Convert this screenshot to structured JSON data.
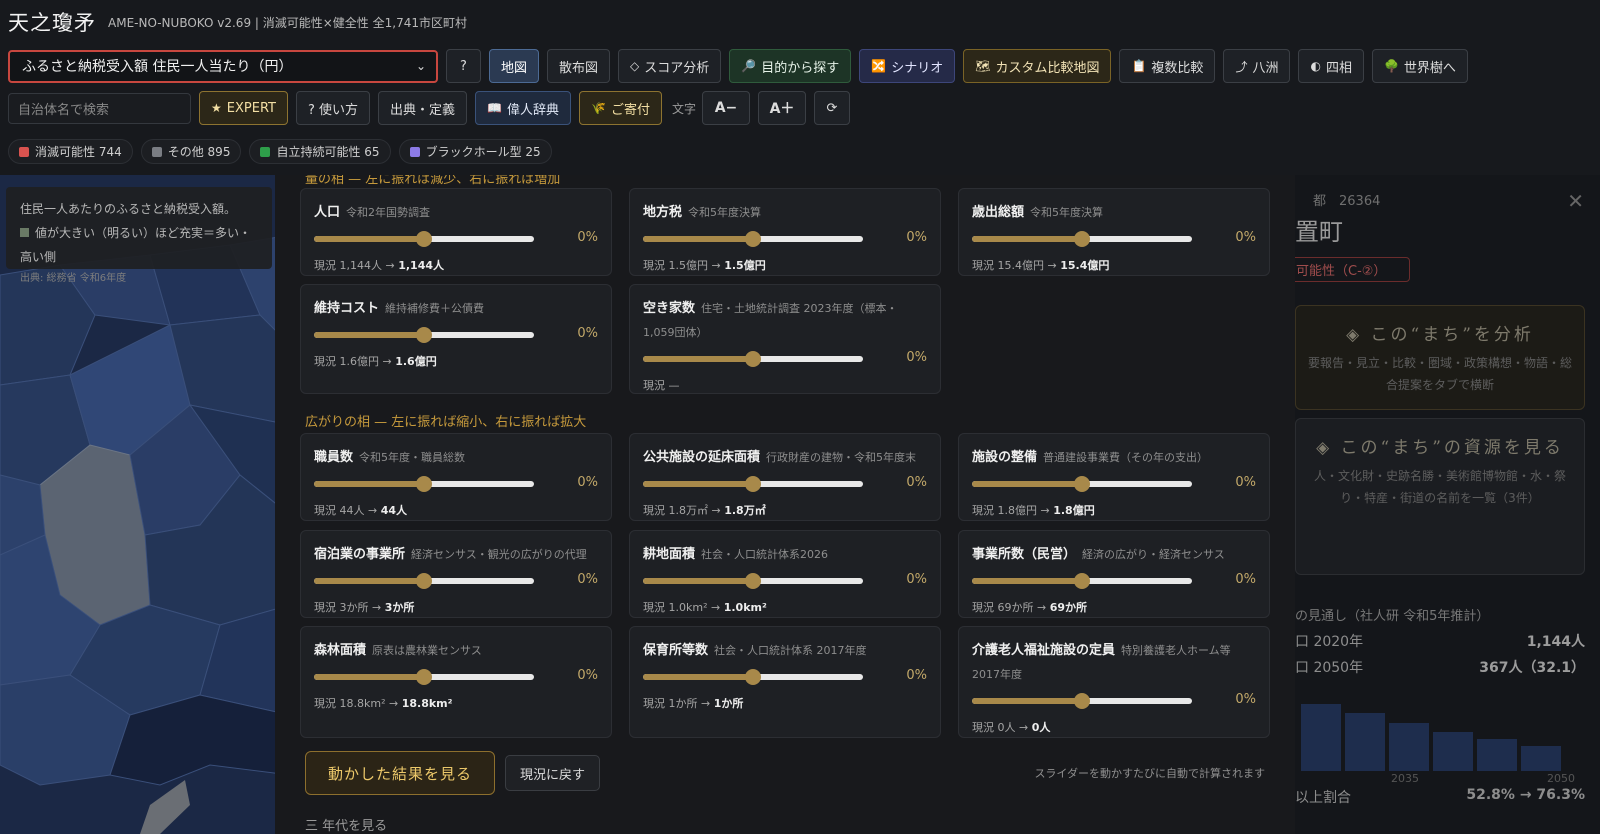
{
  "app": {
    "title": "天之瓊矛",
    "subtitle": "AME-NO-NUBOKO v2.69 | 消滅可能性×健全性 全1,741市区町村"
  },
  "toolbar": {
    "metric_select": "ふるさと納税受入額 住民一人当たり（円）",
    "help": "?",
    "buttons": [
      "地図",
      "散布図",
      "スコア分析",
      "目的から探す",
      "シナリオ",
      "カスタム比較地図",
      "複数比較",
      "八洲",
      "四相",
      "世界樹へ"
    ],
    "active": "地図"
  },
  "toolbar2": {
    "search_placeholder": "自治体名で検索",
    "expert": "EXPERT",
    "howto": "? 使い方",
    "sources": "出典・定義",
    "dictionary": "偉人辞典",
    "donate": "ご寄付",
    "text_label": "文字",
    "font_down": "A−",
    "font_up": "A＋",
    "refresh": "⟳"
  },
  "legend": [
    {
      "label": "消滅可能性 744",
      "color": "#d9534f"
    },
    {
      "label": "その他 895",
      "color": "#7a7d83"
    },
    {
      "label": "自立持続可能性 65",
      "color": "#2e9e4a"
    },
    {
      "label": "ブラックホール型 25",
      "color": "#8c7ae6"
    }
  ],
  "map_info": {
    "line1": "住民一人あたりのふるさと納税受入額。",
    "line2": "値が大きい（明るい）ほど充実＝多い・高い側",
    "source": "出典: 総務省 令和6年度"
  },
  "sim": {
    "section1": "量の相 — 左に振れば減少、右に振れば増加",
    "section2": "広がりの相 — 左に振れば縮小、右に振れば拡大",
    "sliders1": [
      {
        "title": "人口",
        "note": "令和2年国勢調査",
        "value": 0.5,
        "pct": "0%",
        "cur": "現況 1,144人 → ",
        "after": "1,144人"
      },
      {
        "title": "地方税",
        "note": "令和5年度決算",
        "value": 0.5,
        "pct": "0%",
        "cur": "現況 1.5億円 → ",
        "after": "1.5億円"
      },
      {
        "title": "歳出総額",
        "note": "令和5年度決算",
        "value": 0.5,
        "pct": "0%",
        "cur": "現況 15.4億円 → ",
        "after": "15.4億円"
      },
      {
        "title": "維持コスト",
        "note": "維持補修費＋公債費",
        "value": 0.5,
        "pct": "0%",
        "cur": "現況 1.6億円 → ",
        "after": "1.6億円"
      },
      {
        "title": "空き家数",
        "note": "住宅・土地統計調査 2023年度（標本・1,059団体）",
        "value": 0.5,
        "pct": "0%",
        "cur": "現況 —",
        "after": ""
      }
    ],
    "sliders2": [
      {
        "title": "職員数",
        "note": "令和5年度・職員総数",
        "value": 0.5,
        "pct": "0%",
        "cur": "現況 44人 → ",
        "after": "44人"
      },
      {
        "title": "公共施設の延床面積",
        "note": "行政財産の建物・令和5年度末",
        "value": 0.5,
        "pct": "0%",
        "cur": "現況 1.8万㎡ → ",
        "after": "1.8万㎡"
      },
      {
        "title": "施設の整備",
        "note": "普通建設事業費（その年の支出）",
        "value": 0.5,
        "pct": "0%",
        "cur": "現況 1.8億円 → ",
        "after": "1.8億円"
      },
      {
        "title": "宿泊業の事業所",
        "note": "経済センサス・観光の広がりの代理",
        "value": 0.5,
        "pct": "0%",
        "cur": "現況 3か所 → ",
        "after": "3か所"
      },
      {
        "title": "耕地面積",
        "note": "社会・人口統計体系2026",
        "value": 0.5,
        "pct": "0%",
        "cur": "現況 1.0km² → ",
        "after": "1.0km²"
      },
      {
        "title": "事業所数（民営）",
        "note": "経済の広がり・経済センサス",
        "value": 0.5,
        "pct": "0%",
        "cur": "現況 69か所 → ",
        "after": "69か所"
      },
      {
        "title": "森林面積",
        "note": "原表は農林業センサス",
        "value": 0.5,
        "pct": "0%",
        "cur": "現況 18.8km² → ",
        "after": "18.8km²"
      },
      {
        "title": "保育所等数",
        "note": "社会・人口統計体系 2017年度",
        "value": 0.5,
        "pct": "0%",
        "cur": "現況 1か所 → ",
        "after": "1か所"
      },
      {
        "title": "介護老人福祉施設の定員",
        "note": "特別養護老人ホーム等 2017年度",
        "value": 0.5,
        "pct": "0%",
        "cur": "現況 0人 → ",
        "after": "0人"
      }
    ],
    "run": "動かした結果を見る",
    "reset": "現況に戻す",
    "auto_note": "スライダーを動かすたびに自動で計算されます",
    "bottom": "三 年代を見る"
  },
  "detail": {
    "code": "都　26364",
    "town": "置町",
    "badge": "可能性（C-②）",
    "card1_title": "◈ この“まち”を分析",
    "card1_sub": "要報告・見立・比較・圏域・政策構想・物語・総合提案をタブで横断",
    "card2_title": "◈ この“まち”の資源を見る",
    "card2_sub": "人・文化財・史跡名勝・美術館博物館・水・祭り・特産・街道の名前を一覧（3件）",
    "projection": "の見通し（社人研 令和5年推計）",
    "pop2020_label": "口 2020年",
    "pop2020": "1,144人",
    "pop2050_label": "口 2050年",
    "pop2050": "367人（32.1）",
    "bars": [
      1.0,
      0.87,
      0.72,
      0.58,
      0.48,
      0.38
    ],
    "year_mid": "2035",
    "year_end": "2050",
    "older_label": "以上割合",
    "older_value": "52.8% → 76.3%"
  },
  "colors": {
    "accent_gold": "#c69a3c",
    "slider": "#a8894a",
    "active_tab": "#2b3a52"
  }
}
